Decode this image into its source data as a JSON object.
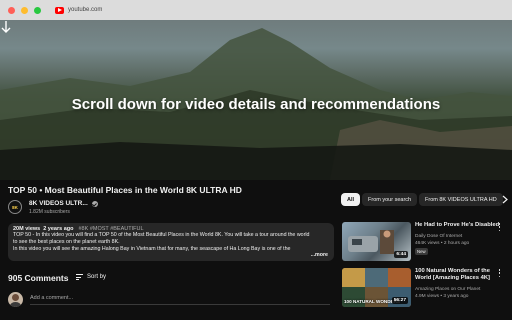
{
  "browser": {
    "url": "youtube.com",
    "favicon_icon": "youtube-icon"
  },
  "hero": {
    "overlay_text": "Scroll down for video details and recommendations",
    "arrow_icon": "arrow-down-icon"
  },
  "video": {
    "title": "TOP 50 • Most Beautiful Places in the World 8K ULTRA HD",
    "channel": {
      "avatar_text": "8K",
      "name": "8K VIDEOS ULTR...",
      "subscribers": "1.82M subscribers",
      "verified_icon": "verified-check-icon"
    },
    "description": {
      "views": "20M views",
      "age": "2 years ago",
      "tags": "#8K #MOST #BEAUTIFUL",
      "line1": "TOP 50 - In this video you will find a TOP 50 of the Most Beautiful Places in the World 8K. You will take a tour around the world",
      "line2": "to see the best places on the planet earth 8K.",
      "line3": "In this video you will see the amazing Halong Bay in Vietnam that for many, the seascape of Ha Long Bay is one of the",
      "more": "...more"
    }
  },
  "comments": {
    "count": "905 Comments",
    "sort_label": "Sort by",
    "placeholder": "Add a comment..."
  },
  "chips": [
    "All",
    "From your search",
    "From 8K VIDEOS ULTRA HD"
  ],
  "recommendations": [
    {
      "title": "He Had to Prove He's Disabled",
      "channel": "Daily Dose Of Internet",
      "views": "464K views",
      "age": "2 hours ago",
      "badge": "New",
      "duration": "6:44"
    },
    {
      "title": "100 Natural Wonders of the World [Amazing Places 4K]",
      "channel": "Amazing Places on Our Planet",
      "views": "4.9M views",
      "age": "3 years ago",
      "thumb_caption": "100 NATURAL WONDERS",
      "duration": "56:27"
    }
  ],
  "colors": {
    "background": "#0f0f0f",
    "chip_active": "#f1f1f1",
    "chip": "#272727",
    "brand_red": "#ff0000"
  }
}
